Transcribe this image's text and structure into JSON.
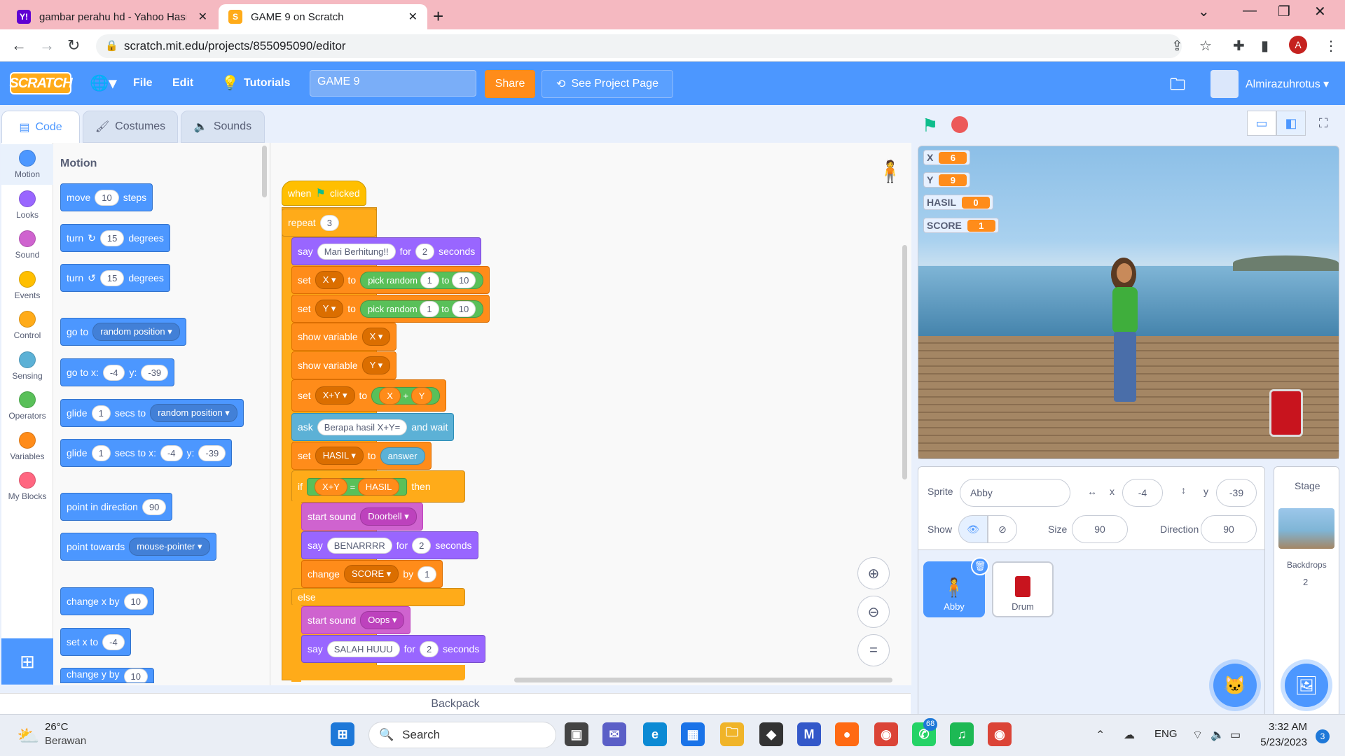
{
  "browser": {
    "tabs": [
      {
        "title": "gambar perahu hd - Yahoo Hasil",
        "favicon": "Y!"
      },
      {
        "title": "GAME 9 on Scratch",
        "favicon": "S"
      }
    ],
    "url": "scratch.mit.edu/projects/855095090/editor"
  },
  "menu": {
    "logo": "SCRATCH",
    "file": "File",
    "edit": "Edit",
    "tutorials": "Tutorials",
    "project_title": "GAME 9",
    "share": "Share",
    "see_project": "See Project Page",
    "username": "Almirazuhrotus"
  },
  "editor_tabs": {
    "code": "Code",
    "costumes": "Costumes",
    "sounds": "Sounds"
  },
  "categories": [
    {
      "label": "Motion",
      "color": "#4c97ff"
    },
    {
      "label": "Looks",
      "color": "#9966ff"
    },
    {
      "label": "Sound",
      "color": "#cf63cf"
    },
    {
      "label": "Events",
      "color": "#ffbf00"
    },
    {
      "label": "Control",
      "color": "#ffab19"
    },
    {
      "label": "Sensing",
      "color": "#5cb1d6"
    },
    {
      "label": "Operators",
      "color": "#59c059"
    },
    {
      "label": "Variables",
      "color": "#ff8c1a"
    },
    {
      "label": "My Blocks",
      "color": "#ff6680"
    }
  ],
  "palette": {
    "title": "Motion",
    "move": {
      "a": "move",
      "v": "10",
      "b": "steps"
    },
    "turn_right": {
      "a": "turn",
      "v": "15",
      "b": "degrees"
    },
    "turn_left": {
      "a": "turn",
      "v": "15",
      "b": "degrees"
    },
    "goto": {
      "a": "go to",
      "d": "random position"
    },
    "gotoxy": {
      "a": "go to x:",
      "x": "-4",
      "b": "y:",
      "y": "-39"
    },
    "glide_to": {
      "a": "glide",
      "v": "1",
      "b": "secs to",
      "d": "random position"
    },
    "glide_xy": {
      "a": "glide",
      "v": "1",
      "b": "secs to x:",
      "x": "-4",
      "c": "y:",
      "y": "-39"
    },
    "point_dir": {
      "a": "point in direction",
      "v": "90"
    },
    "point_towards": {
      "a": "point towards",
      "d": "mouse-pointer"
    },
    "change_x": {
      "a": "change x by",
      "v": "10"
    },
    "set_x": {
      "a": "set x to",
      "v": "-4"
    },
    "change_y": {
      "a": "change y by",
      "v": "10"
    }
  },
  "script": {
    "hat": {
      "a": "when",
      "b": "clicked"
    },
    "repeat": {
      "a": "repeat",
      "v": "3"
    },
    "say1": {
      "a": "say",
      "msg": "Mari Berhitung!!",
      "b": "for",
      "v": "2",
      "c": "seconds"
    },
    "setx": {
      "a": "set",
      "var": "X",
      "b": "to",
      "op": "pick random",
      "v1": "1",
      "c": "to",
      "v2": "10"
    },
    "sety": {
      "a": "set",
      "var": "Y",
      "b": "to",
      "op": "pick random",
      "v1": "1",
      "c": "to",
      "v2": "10"
    },
    "showx": {
      "a": "show variable",
      "var": "X"
    },
    "showy": {
      "a": "show variable",
      "var": "Y"
    },
    "setxy": {
      "a": "set",
      "var": "X+Y",
      "b": "to",
      "l": "X",
      "op": "+",
      "r": "Y"
    },
    "ask": {
      "a": "ask",
      "msg": "Berapa hasil X+Y=",
      "b": "and wait"
    },
    "sethasil": {
      "a": "set",
      "var": "HASIL",
      "b": "to",
      "v": "answer"
    },
    "if": {
      "a": "if",
      "l": "X+Y",
      "op": "=",
      "r": "HASIL",
      "b": "then"
    },
    "snd1": {
      "a": "start sound",
      "d": "Doorbell"
    },
    "say2": {
      "a": "say",
      "msg": "BENARRRR",
      "b": "for",
      "v": "2",
      "c": "seconds"
    },
    "change": {
      "a": "change",
      "var": "SCORE",
      "b": "by",
      "v": "1"
    },
    "else": "else",
    "snd2": {
      "a": "start sound",
      "d": "Oops"
    },
    "say3": {
      "a": "say",
      "msg": "SALAH HUUU",
      "b": "for",
      "v": "2",
      "c": "seconds"
    }
  },
  "backpack": "Backpack",
  "monitors": [
    {
      "name": "X",
      "value": "6"
    },
    {
      "name": "Y",
      "value": "9"
    },
    {
      "name": "HASIL",
      "value": "0"
    },
    {
      "name": "SCORE",
      "value": "1"
    }
  ],
  "sprite_info": {
    "sprite_label": "Sprite",
    "sprite_name": "Abby",
    "x_label": "x",
    "x": "-4",
    "y_label": "y",
    "y": "-39",
    "show_label": "Show",
    "size_label": "Size",
    "size": "90",
    "direction_label": "Direction",
    "direction": "90"
  },
  "sprites": [
    {
      "name": "Abby"
    },
    {
      "name": "Drum"
    }
  ],
  "stage_panel": {
    "title": "Stage",
    "backdrops_label": "Backdrops",
    "backdrops_count": "2"
  },
  "taskbar": {
    "weather_temp": "26°C",
    "weather_desc": "Berawan",
    "search": "Search",
    "lang": "ENG",
    "time": "3:32 AM",
    "date": "5/23/2023",
    "whatsapp_badge": "68",
    "notif_badge": "3"
  }
}
